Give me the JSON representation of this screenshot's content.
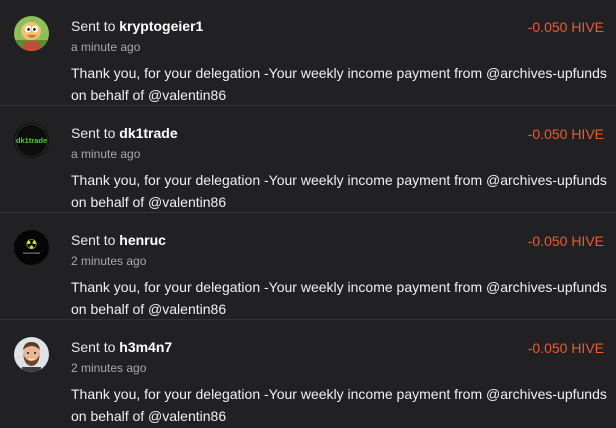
{
  "transfers": [
    {
      "sent_prefix": "Sent to",
      "recipient": "kryptogeier1",
      "time": "a minute ago",
      "amount": "-0.050 HIVE",
      "memo": "Thank you, for your delegation -Your weekly income payment from @archives-upfunds on behalf of @valentin86",
      "avatar": "cartoon-vulture-icon"
    },
    {
      "sent_prefix": "Sent to",
      "recipient": "dk1trade",
      "time": "a minute ago",
      "amount": "-0.050 HIVE",
      "memo": "Thank you, for your delegation -Your weekly income payment from @archives-upfunds on behalf of @valentin86",
      "avatar": "dk1trade-logo-icon",
      "avatar_text": "dk1trade"
    },
    {
      "sent_prefix": "Sent to",
      "recipient": "henruc",
      "time": "2 minutes ago",
      "amount": "-0.050 HIVE",
      "memo": "Thank you, for your delegation -Your weekly income payment from @archives-upfunds on behalf of @valentin86",
      "avatar": "radioactive-logo-icon"
    },
    {
      "sent_prefix": "Sent to",
      "recipient": "h3m4n7",
      "time": "2 minutes ago",
      "amount": "-0.050 HIVE",
      "memo": "Thank you, for your delegation -Your weekly income payment from @archives-upfunds on behalf of @valentin86",
      "avatar": "bearded-man-icon"
    }
  ],
  "colors": {
    "background": "#212124",
    "amount": "#ec5a2e",
    "divider": "#333337",
    "muted": "#a9a9ad"
  }
}
